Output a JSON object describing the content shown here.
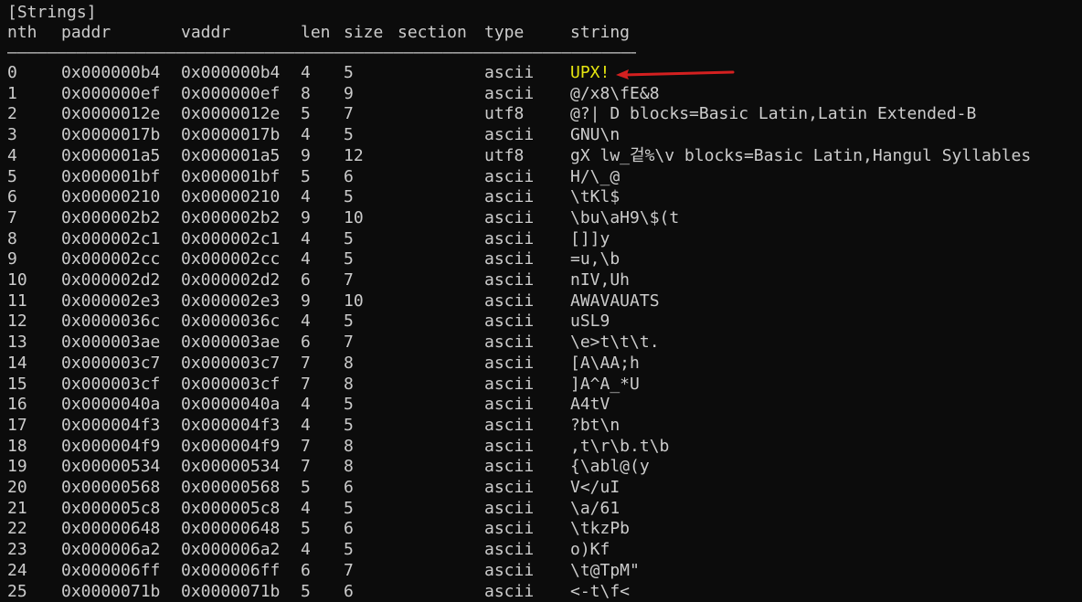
{
  "title": "[Strings]",
  "headers": {
    "nth": "nth",
    "paddr": "paddr",
    "vaddr": "vaddr",
    "len": "len",
    "size": "size",
    "section": "section",
    "type": "type",
    "string": "string"
  },
  "separator": "――――――――――――――――――――――――――――――――――――――――――――――――――――――――――――――――――――――――――――――――――――――――――――――――――――",
  "highlight_color": "#e5e510",
  "arrow_color": "#d42020",
  "rows": [
    {
      "nth": "0",
      "paddr": "0x000000b4",
      "vaddr": "0x000000b4",
      "len": "4",
      "size": "5",
      "type": "ascii",
      "string": "UPX!"
    },
    {
      "nth": "1",
      "paddr": "0x000000ef",
      "vaddr": "0x000000ef",
      "len": "8",
      "size": "9",
      "type": "ascii",
      "string": "@/x8\\fE&8"
    },
    {
      "nth": "2",
      "paddr": "0x0000012e",
      "vaddr": "0x0000012e",
      "len": "5",
      "size": "7",
      "type": "utf8",
      "string": "@?| D blocks=Basic Latin,Latin Extended-B"
    },
    {
      "nth": "3",
      "paddr": "0x0000017b",
      "vaddr": "0x0000017b",
      "len": "4",
      "size": "5",
      "type": "ascii",
      "string": "GNU\\n"
    },
    {
      "nth": "4",
      "paddr": "0x000001a5",
      "vaddr": "0x000001a5",
      "len": "9",
      "size": "12",
      "type": "utf8",
      "string": "gX lw_겉%\\v blocks=Basic Latin,Hangul Syllables"
    },
    {
      "nth": "5",
      "paddr": "0x000001bf",
      "vaddr": "0x000001bf",
      "len": "5",
      "size": "6",
      "type": "ascii",
      "string": "H/\\_@"
    },
    {
      "nth": "6",
      "paddr": "0x00000210",
      "vaddr": "0x00000210",
      "len": "4",
      "size": "5",
      "type": "ascii",
      "string": "\\tKl$"
    },
    {
      "nth": "7",
      "paddr": "0x000002b2",
      "vaddr": "0x000002b2",
      "len": "9",
      "size": "10",
      "type": "ascii",
      "string": "\\bu\\aH9\\$(t"
    },
    {
      "nth": "8",
      "paddr": "0x000002c1",
      "vaddr": "0x000002c1",
      "len": "4",
      "size": "5",
      "type": "ascii",
      "string": "[]]y"
    },
    {
      "nth": "9",
      "paddr": "0x000002cc",
      "vaddr": "0x000002cc",
      "len": "4",
      "size": "5",
      "type": "ascii",
      "string": "=u,\\b"
    },
    {
      "nth": "10",
      "paddr": "0x000002d2",
      "vaddr": "0x000002d2",
      "len": "6",
      "size": "7",
      "type": "ascii",
      "string": "nIV,Uh"
    },
    {
      "nth": "11",
      "paddr": "0x000002e3",
      "vaddr": "0x000002e3",
      "len": "9",
      "size": "10",
      "type": "ascii",
      "string": "AWAVAUATS"
    },
    {
      "nth": "12",
      "paddr": "0x0000036c",
      "vaddr": "0x0000036c",
      "len": "4",
      "size": "5",
      "type": "ascii",
      "string": "uSL9"
    },
    {
      "nth": "13",
      "paddr": "0x000003ae",
      "vaddr": "0x000003ae",
      "len": "6",
      "size": "7",
      "type": "ascii",
      "string": "\\e>t\\t\\t."
    },
    {
      "nth": "14",
      "paddr": "0x000003c7",
      "vaddr": "0x000003c7",
      "len": "7",
      "size": "8",
      "type": "ascii",
      "string": "[A\\AA;h"
    },
    {
      "nth": "15",
      "paddr": "0x000003cf",
      "vaddr": "0x000003cf",
      "len": "7",
      "size": "8",
      "type": "ascii",
      "string": "]A^A_*U"
    },
    {
      "nth": "16",
      "paddr": "0x0000040a",
      "vaddr": "0x0000040a",
      "len": "4",
      "size": "5",
      "type": "ascii",
      "string": "A4tV"
    },
    {
      "nth": "17",
      "paddr": "0x000004f3",
      "vaddr": "0x000004f3",
      "len": "4",
      "size": "5",
      "type": "ascii",
      "string": "?bt\\n"
    },
    {
      "nth": "18",
      "paddr": "0x000004f9",
      "vaddr": "0x000004f9",
      "len": "7",
      "size": "8",
      "type": "ascii",
      "string": ",t\\r\\b.t\\b"
    },
    {
      "nth": "19",
      "paddr": "0x00000534",
      "vaddr": "0x00000534",
      "len": "7",
      "size": "8",
      "type": "ascii",
      "string": "{\\abl@(y"
    },
    {
      "nth": "20",
      "paddr": "0x00000568",
      "vaddr": "0x00000568",
      "len": "5",
      "size": "6",
      "type": "ascii",
      "string": "V</uI"
    },
    {
      "nth": "21",
      "paddr": "0x000005c8",
      "vaddr": "0x000005c8",
      "len": "4",
      "size": "5",
      "type": "ascii",
      "string": "\\a/61"
    },
    {
      "nth": "22",
      "paddr": "0x00000648",
      "vaddr": "0x00000648",
      "len": "5",
      "size": "6",
      "type": "ascii",
      "string": "\\tkzPb"
    },
    {
      "nth": "23",
      "paddr": "0x000006a2",
      "vaddr": "0x000006a2",
      "len": "4",
      "size": "5",
      "type": "ascii",
      "string": "o)Kf"
    },
    {
      "nth": "24",
      "paddr": "0x000006ff",
      "vaddr": "0x000006ff",
      "len": "6",
      "size": "7",
      "type": "ascii",
      "string": "\\t@TpM\""
    },
    {
      "nth": "25",
      "paddr": "0x0000071b",
      "vaddr": "0x0000071b",
      "len": "5",
      "size": "6",
      "type": "ascii",
      "string": "<-t\\f<"
    }
  ]
}
